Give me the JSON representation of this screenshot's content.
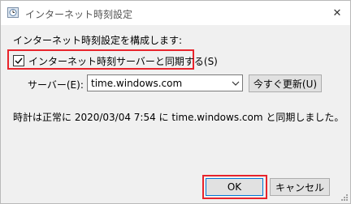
{
  "window": {
    "title": "インターネット時刻設定",
    "close_glyph": "✕"
  },
  "main": {
    "configure_label": "インターネット時刻設定を構成します:",
    "sync_checkbox": {
      "label": "インターネット時刻サーバーと同期する(S)",
      "checked": true
    },
    "server_label": "サーバー(E):",
    "server_value": "time.windows.com",
    "update_button": "今すぐ更新(U)",
    "status_text": "時計は正常に 2020/03/04 7:54 に time.windows.com と同期しました。"
  },
  "footer": {
    "ok_label": "OK",
    "cancel_label": "キャンセル"
  },
  "colors": {
    "highlight": "#e8242c",
    "dialog_bg": "#f0f0f0",
    "button_bg": "#e1e1e1",
    "default_button_border": "#0078d7"
  },
  "icons": {
    "title": "clock-globe-icon",
    "checkbox_mark": "checkmark-icon",
    "combo": "chevron-down-icon",
    "close": "close-icon",
    "resize": "resize-grip-icon"
  }
}
